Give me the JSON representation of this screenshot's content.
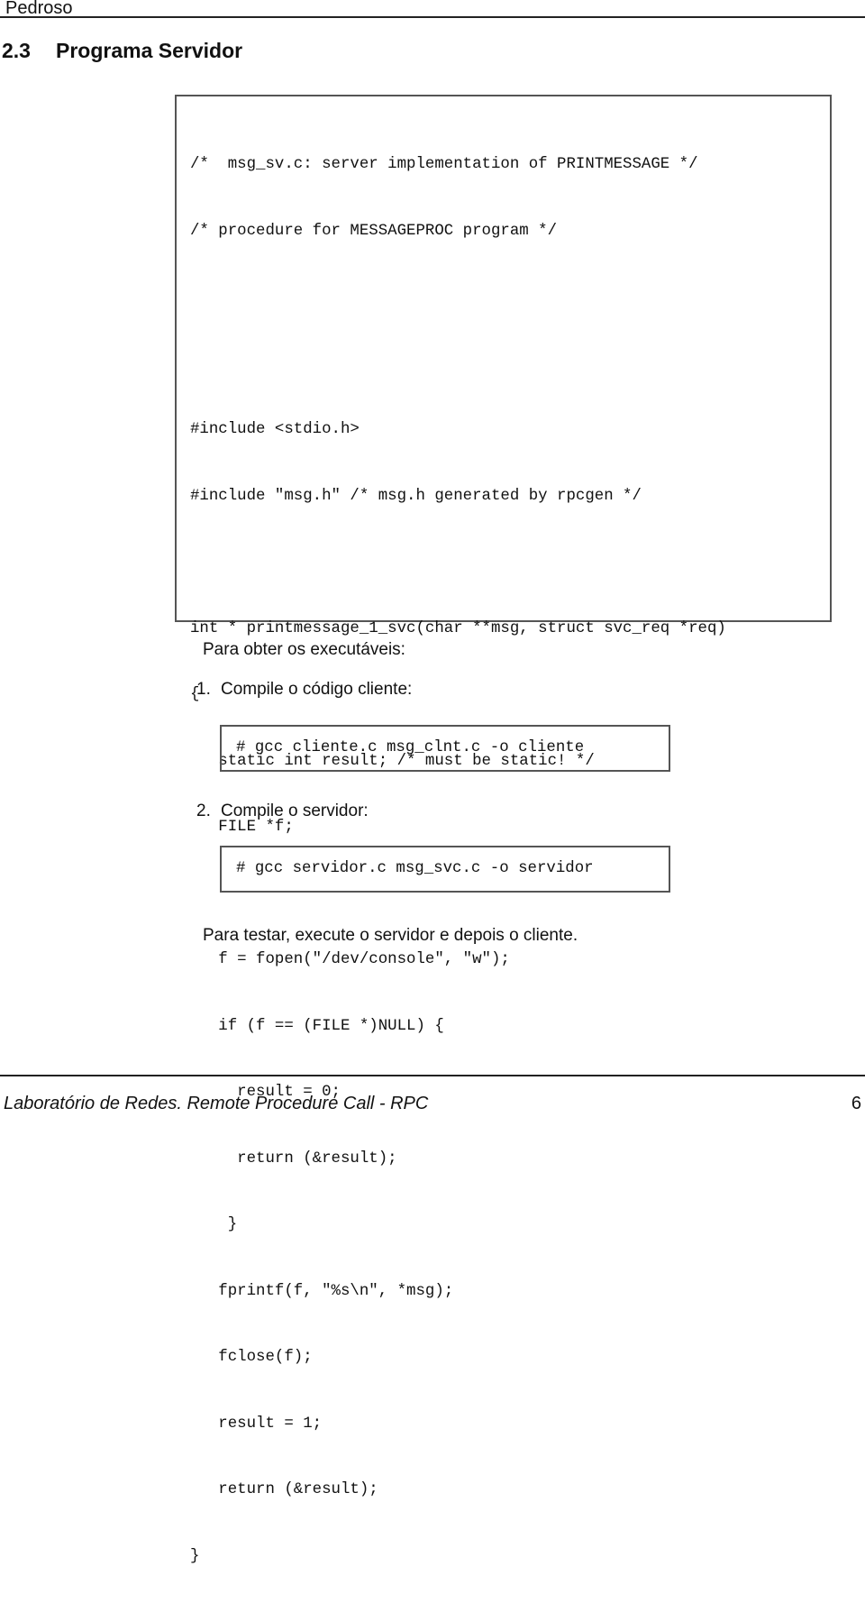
{
  "header": {
    "author": "Pedroso"
  },
  "section": {
    "number": "2.3",
    "title": "Programa Servidor"
  },
  "code_listing": {
    "lines": [
      "/*  msg_sv.c: server implementation of PRINTMESSAGE */",
      "/* procedure for MESSAGEPROC program */",
      "",
      "",
      "#include <stdio.h>",
      "#include \"msg.h\" /* msg.h generated by rpcgen */",
      "",
      "int * printmessage_1_svc(char **msg, struct svc_req *req)",
      "{",
      "   static int result; /* must be static! */",
      "   FILE *f;",
      "",
      "   f = fopen(\"/dev/console\", \"w\");",
      "   if (f == (FILE *)NULL) {",
      "     result = 0;",
      "     return (&result);",
      "    }",
      "   fprintf(f, \"%s\\n\", *msg);",
      "   fclose(f);",
      "   result = 1;",
      "   return (&result);",
      "}"
    ]
  },
  "instructions": {
    "intro": "Para obter os executáveis:",
    "steps": [
      {
        "number": "1.",
        "text": "Compile o código cliente:",
        "command": "# gcc cliente.c msg_clnt.c -o cliente"
      },
      {
        "number": "2.",
        "text": "Compile o servidor:",
        "command": "# gcc servidor.c msg_svc.c -o servidor"
      }
    ],
    "closing": "Para testar, execute o servidor e depois o cliente."
  },
  "footer": {
    "title": "Laboratório de Redes. Remote Procedure Call - RPC",
    "page_number": "6"
  }
}
